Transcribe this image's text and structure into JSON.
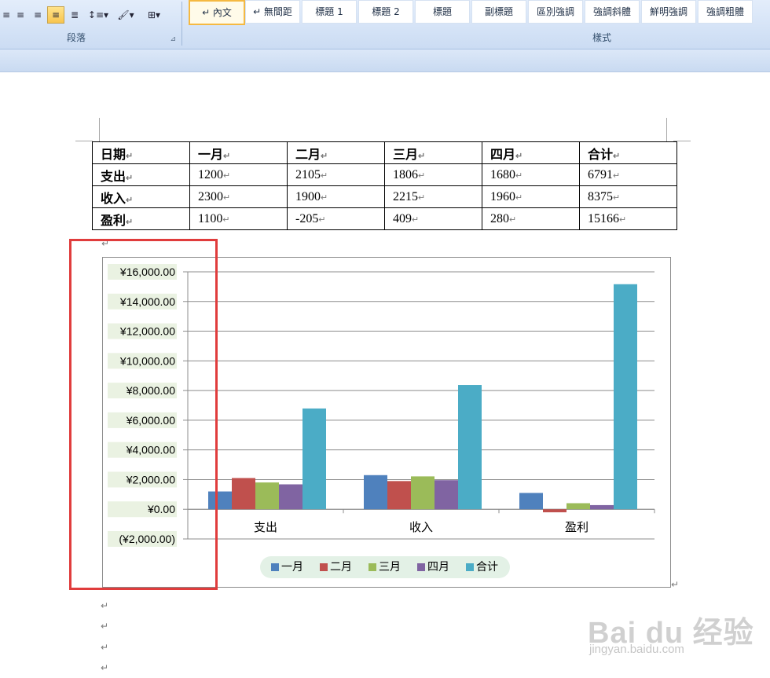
{
  "ribbon": {
    "paragraph": {
      "label": "段落",
      "buttons": [
        {
          "name": "align-left-button",
          "glyph": "≡",
          "active": false
        },
        {
          "name": "align-center-button",
          "glyph": "≡",
          "active": false
        },
        {
          "name": "align-right-button",
          "glyph": "≡",
          "active": false
        },
        {
          "name": "justify-button",
          "glyph": "≡",
          "active": true
        },
        {
          "name": "distributed-button",
          "glyph": "≣",
          "active": false
        },
        {
          "name": "line-spacing-button",
          "glyph": "↕≡▾",
          "active": false
        },
        {
          "name": "shading-button",
          "glyph": "🖌▾",
          "active": false
        },
        {
          "name": "borders-button",
          "glyph": "⊞▾",
          "active": false
        }
      ]
    },
    "styles": {
      "label": "樣式",
      "items": [
        "↵ 內文",
        "↵ 無間距",
        "標題 1",
        "標題 2",
        "標題",
        "副標題",
        "區別強調",
        "強調斜體",
        "鮮明強調",
        "強調粗體"
      ],
      "selected_index": 0
    }
  },
  "table": {
    "header": [
      "日期",
      "一月",
      "二月",
      "三月",
      "四月",
      "合计"
    ],
    "rows": [
      [
        "支出",
        "1200",
        "2105",
        "1806",
        "1680",
        "6791"
      ],
      [
        "收入",
        "2300",
        "1900",
        "2215",
        "1960",
        "8375"
      ],
      [
        "盈利",
        "1100",
        "-205",
        "409",
        "280",
        "15166"
      ]
    ]
  },
  "chart_data": {
    "type": "bar",
    "categories": [
      "支出",
      "收入",
      "盈利"
    ],
    "series": [
      {
        "name": "一月",
        "color": "#4f81bd",
        "values": [
          1200,
          2300,
          1100
        ]
      },
      {
        "name": "二月",
        "color": "#c0504d",
        "values": [
          2105,
          1900,
          -205
        ]
      },
      {
        "name": "三月",
        "color": "#9bbb59",
        "values": [
          1806,
          2215,
          409
        ]
      },
      {
        "name": "四月",
        "color": "#8064a2",
        "values": [
          1680,
          1960,
          280
        ]
      },
      {
        "name": "合计",
        "color": "#4bacc6",
        "values": [
          6791,
          8375,
          15166
        ]
      }
    ],
    "y_ticks": [
      -2000,
      0,
      2000,
      4000,
      6000,
      8000,
      10000,
      12000,
      14000,
      16000
    ],
    "y_tick_labels": [
      "(¥2,000.00)",
      "¥0.00",
      "¥2,000.00",
      "¥4,000.00",
      "¥6,000.00",
      "¥8,000.00",
      "¥10,000.00",
      "¥12,000.00",
      "¥14,000.00",
      "¥16,000.00"
    ],
    "ylim": [
      -2000,
      16000
    ],
    "grid": true,
    "legend": "bottom",
    "highlight_color": "#e03c3c"
  },
  "watermark": {
    "brand": "Bai du 经验",
    "url": "jingyan.baidu.com"
  },
  "para_mark": "↵"
}
